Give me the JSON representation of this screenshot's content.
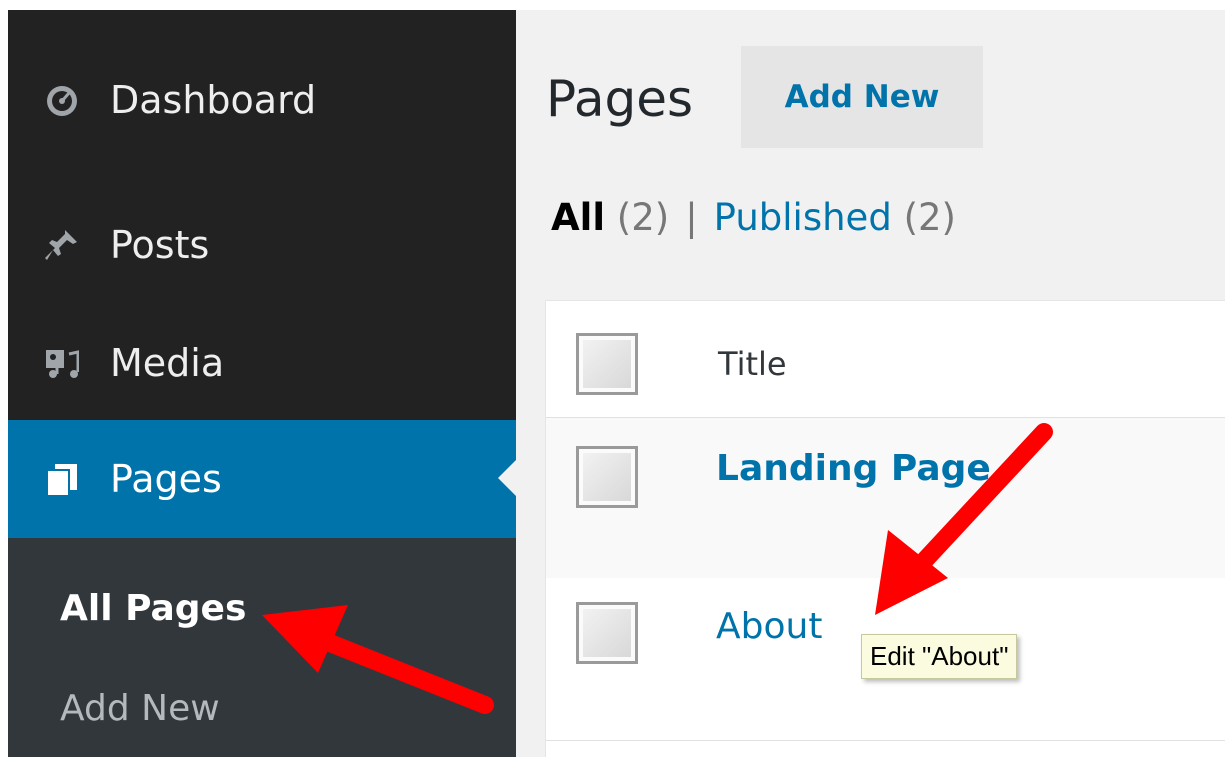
{
  "sidebar": {
    "items": [
      {
        "label": "Dashboard",
        "icon": "dashboard-icon"
      },
      {
        "label": "Posts",
        "icon": "pin-icon"
      },
      {
        "label": "Media",
        "icon": "media-icon"
      },
      {
        "label": "Pages",
        "icon": "pages-icon",
        "active": true
      }
    ],
    "submenu": [
      {
        "label": "All Pages",
        "current": true
      },
      {
        "label": "Add New"
      }
    ],
    "colors": {
      "bg": "#222222",
      "active": "#0073aa",
      "submenu_bg": "#32373c"
    }
  },
  "main": {
    "title": "Pages",
    "add_new_label": "Add New",
    "filters": {
      "all_label": "All",
      "all_count": "(2)",
      "separator": "|",
      "published_label": "Published",
      "published_count": "(2)"
    },
    "table": {
      "column_title": "Title",
      "rows": [
        {
          "title": "Landing Page"
        },
        {
          "title": "About"
        }
      ]
    },
    "tooltip": "Edit \"About\""
  },
  "annotation_color": "#ff0000"
}
